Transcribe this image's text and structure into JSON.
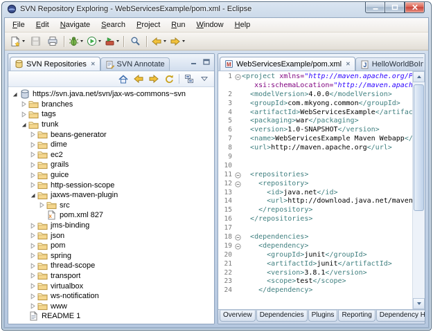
{
  "window": {
    "title": "SVN Repository Exploring - WebServicesExample/pom.xml - Eclipse",
    "icon": "eclipse-window-icon",
    "controls": [
      {
        "name": "minimize-button",
        "icon": "minimize-icon"
      },
      {
        "name": "maximize-button",
        "icon": "maximize-icon"
      },
      {
        "name": "close-button",
        "icon": "close-icon"
      }
    ]
  },
  "menu_bar": {
    "items": [
      "File",
      "Edit",
      "Navigate",
      "Search",
      "Project",
      "Run",
      "Window",
      "Help"
    ]
  },
  "main_toolbar": {
    "items": [
      {
        "icon": "new-wizard-icon",
        "dropdown": true
      },
      {
        "icon": "save-icon",
        "disabled": true
      },
      {
        "icon": "print-icon"
      },
      {
        "sep": true
      },
      {
        "icon": "debug-icon",
        "dropdown": true
      },
      {
        "icon": "run-icon",
        "dropdown": true
      },
      {
        "icon": "external-tools-icon",
        "dropdown": true
      },
      {
        "sep": true
      },
      {
        "icon": "search-icon"
      },
      {
        "sep": true
      },
      {
        "icon": "back-icon",
        "dropdown": true
      },
      {
        "icon": "forward-icon",
        "dropdown": true
      }
    ]
  },
  "svn_view": {
    "tabs": [
      {
        "label": "SVN Repositories",
        "icon": "svn-repositories-icon",
        "active": true,
        "closable": true
      },
      {
        "label": "SVN Annotate",
        "icon": "svn-annotate-icon",
        "active": false,
        "closable": false
      }
    ],
    "view_controls": [
      {
        "name": "minimize-view-button",
        "icon": "minimize-view-icon"
      },
      {
        "name": "maximize-view-button",
        "icon": "maximize-view-icon"
      }
    ],
    "toolbar": [
      {
        "icon": "home-icon"
      },
      {
        "icon": "back-icon"
      },
      {
        "icon": "forward-icon"
      },
      {
        "icon": "refresh-icon"
      },
      {
        "sep": true
      },
      {
        "icon": "collapse-all-icon"
      },
      {
        "icon": "view-menu-icon"
      }
    ],
    "tree": [
      {
        "label": "https://svn.java.net/svn/jax-ws-commons~svn",
        "icon": "svn-repository-icon",
        "level": 0,
        "state": "expanded"
      },
      {
        "label": "branches",
        "icon": "folder-icon",
        "level": 1,
        "state": "collapsed"
      },
      {
        "label": "tags",
        "icon": "folder-icon",
        "level": 1,
        "state": "collapsed"
      },
      {
        "label": "trunk",
        "icon": "folder-icon",
        "level": 1,
        "state": "expanded"
      },
      {
        "label": "beans-generator",
        "icon": "folder-icon",
        "level": 2,
        "state": "collapsed"
      },
      {
        "label": "dime",
        "icon": "folder-icon",
        "level": 2,
        "state": "collapsed"
      },
      {
        "label": "ec2",
        "icon": "folder-icon",
        "level": 2,
        "state": "collapsed"
      },
      {
        "label": "grails",
        "icon": "folder-icon",
        "level": 2,
        "state": "collapsed"
      },
      {
        "label": "guice",
        "icon": "folder-icon",
        "level": 2,
        "state": "collapsed"
      },
      {
        "label": "http-session-scope",
        "icon": "folder-icon",
        "level": 2,
        "state": "collapsed"
      },
      {
        "label": "jaxws-maven-plugin",
        "icon": "folder-icon",
        "level": 2,
        "state": "expanded"
      },
      {
        "label": "src",
        "icon": "folder-icon",
        "level": 3,
        "state": "collapsed"
      },
      {
        "label": "pom.xml 827",
        "icon": "xml-file-icon",
        "level": 3,
        "state": "leaf"
      },
      {
        "label": "jms-binding",
        "icon": "folder-icon",
        "level": 2,
        "state": "collapsed"
      },
      {
        "label": "json",
        "icon": "folder-icon",
        "level": 2,
        "state": "collapsed"
      },
      {
        "label": "pom",
        "icon": "folder-icon",
        "level": 2,
        "state": "collapsed"
      },
      {
        "label": "spring",
        "icon": "folder-icon",
        "level": 2,
        "state": "collapsed"
      },
      {
        "label": "thread-scope",
        "icon": "folder-icon",
        "level": 2,
        "state": "collapsed"
      },
      {
        "label": "transport",
        "icon": "folder-icon",
        "level": 2,
        "state": "collapsed"
      },
      {
        "label": "virtualbox",
        "icon": "folder-icon",
        "level": 2,
        "state": "collapsed"
      },
      {
        "label": "ws-notification",
        "icon": "folder-icon",
        "level": 2,
        "state": "collapsed"
      },
      {
        "label": "www",
        "icon": "folder-icon",
        "level": 2,
        "state": "collapsed"
      },
      {
        "label": "README 1",
        "icon": "text-file-icon",
        "level": 1,
        "state": "leaf"
      }
    ]
  },
  "editor": {
    "tabs": [
      {
        "label": "WebServicesExample/pom.xml",
        "icon": "pom-file-icon",
        "active": true,
        "closable": true
      },
      {
        "label": "HelloWorldBoImpl.java",
        "icon": "java-file-icon",
        "active": false,
        "closable": false
      }
    ],
    "scrollbar": {
      "up_icon": "scroll-up-icon",
      "down_icon": "scroll-down-icon"
    },
    "bottom_tabs": [
      "Overview",
      "Dependencies",
      "Plugins",
      "Reporting",
      "Dependency Hierarchy"
    ],
    "source_lines": [
      {
        "n": "1",
        "fold": true,
        "t": [
          [
            "tag",
            "<project"
          ],
          [
            "pl",
            " "
          ],
          [
            "attr",
            "xmlns="
          ],
          [
            "val",
            "\"http://maven.apache.org/P"
          ]
        ]
      },
      {
        "n": "",
        "t": [
          [
            "pl",
            "   "
          ],
          [
            "attr",
            "xsi:schemaLocation="
          ],
          [
            "val",
            "\"http://maven.apache"
          ]
        ]
      },
      {
        "n": "2",
        "t": [
          [
            "pl",
            "  "
          ],
          [
            "tag",
            "<modelVersion>"
          ],
          [
            "tx",
            "4.0.0"
          ],
          [
            "tag",
            "</modelVersion>"
          ]
        ]
      },
      {
        "n": "3",
        "t": [
          [
            "pl",
            "  "
          ],
          [
            "tag",
            "<groupId>"
          ],
          [
            "tx",
            "com.mkyong.common"
          ],
          [
            "tag",
            "</groupId>"
          ]
        ]
      },
      {
        "n": "4",
        "t": [
          [
            "pl",
            "  "
          ],
          [
            "tag",
            "<artifactId>"
          ],
          [
            "tx",
            "WebServicesExample"
          ],
          [
            "tag",
            "</artifactId>"
          ]
        ]
      },
      {
        "n": "5",
        "t": [
          [
            "pl",
            "  "
          ],
          [
            "tag",
            "<packaging>"
          ],
          [
            "tx",
            "war"
          ],
          [
            "tag",
            "</packaging>"
          ]
        ]
      },
      {
        "n": "6",
        "t": [
          [
            "pl",
            "  "
          ],
          [
            "tag",
            "<version>"
          ],
          [
            "tx",
            "1.0-SNAPSHOT"
          ],
          [
            "tag",
            "</version>"
          ]
        ]
      },
      {
        "n": "7",
        "t": [
          [
            "pl",
            "  "
          ],
          [
            "tag",
            "<name>"
          ],
          [
            "tx",
            "WebServicesExample Maven Webapp"
          ],
          [
            "tag",
            "</name>"
          ]
        ]
      },
      {
        "n": "8",
        "t": [
          [
            "pl",
            "  "
          ],
          [
            "tag",
            "<url>"
          ],
          [
            "tx",
            "http://maven.apache.org"
          ],
          [
            "tag",
            "</url>"
          ]
        ]
      },
      {
        "n": "9",
        "t": []
      },
      {
        "n": "10",
        "t": []
      },
      {
        "n": "11",
        "fold": true,
        "t": [
          [
            "pl",
            "  "
          ],
          [
            "tag",
            "<repositories>"
          ]
        ]
      },
      {
        "n": "12",
        "fold": true,
        "t": [
          [
            "pl",
            "    "
          ],
          [
            "tag",
            "<repository>"
          ]
        ]
      },
      {
        "n": "13",
        "t": [
          [
            "pl",
            "      "
          ],
          [
            "tag",
            "<id>"
          ],
          [
            "tx",
            "java.net"
          ],
          [
            "tag",
            "</id>"
          ]
        ]
      },
      {
        "n": "14",
        "t": [
          [
            "pl",
            "      "
          ],
          [
            "tag",
            "<url>"
          ],
          [
            "tx",
            "http://download.java.net/maven"
          ]
        ]
      },
      {
        "n": "15",
        "t": [
          [
            "pl",
            "    "
          ],
          [
            "tag",
            "</repository>"
          ]
        ]
      },
      {
        "n": "16",
        "t": [
          [
            "pl",
            "  "
          ],
          [
            "tag",
            "</repositories>"
          ]
        ]
      },
      {
        "n": "17",
        "t": []
      },
      {
        "n": "18",
        "fold": true,
        "t": [
          [
            "pl",
            "  "
          ],
          [
            "tag",
            "<dependencies>"
          ]
        ]
      },
      {
        "n": "19",
        "fold": true,
        "t": [
          [
            "pl",
            "    "
          ],
          [
            "tag",
            "<dependency>"
          ]
        ]
      },
      {
        "n": "20",
        "t": [
          [
            "pl",
            "      "
          ],
          [
            "tag",
            "<groupId>"
          ],
          [
            "tx",
            "junit"
          ],
          [
            "tag",
            "</groupId>"
          ]
        ]
      },
      {
        "n": "21",
        "t": [
          [
            "pl",
            "      "
          ],
          [
            "tag",
            "<artifactId>"
          ],
          [
            "tx",
            "junit"
          ],
          [
            "tag",
            "</artifactId>"
          ]
        ]
      },
      {
        "n": "22",
        "t": [
          [
            "pl",
            "      "
          ],
          [
            "tag",
            "<version>"
          ],
          [
            "tx",
            "3.8.1"
          ],
          [
            "tag",
            "</version>"
          ]
        ]
      },
      {
        "n": "23",
        "t": [
          [
            "pl",
            "      "
          ],
          [
            "tag",
            "<scope>"
          ],
          [
            "tx",
            "test"
          ],
          [
            "tag",
            "</scope>"
          ]
        ]
      },
      {
        "n": "24",
        "t": [
          [
            "pl",
            "    "
          ],
          [
            "tag",
            "</dependency>"
          ]
        ]
      }
    ]
  },
  "colors": {
    "xml_tag": "#3f7f7f",
    "xml_attribute_name": "#7f007f",
    "xml_attribute_value": "#2a00ff",
    "xml_text": "#000000",
    "line_number": "#787878",
    "close_button_red": "#c8453c",
    "workbench_background": "#c3d3e8"
  }
}
